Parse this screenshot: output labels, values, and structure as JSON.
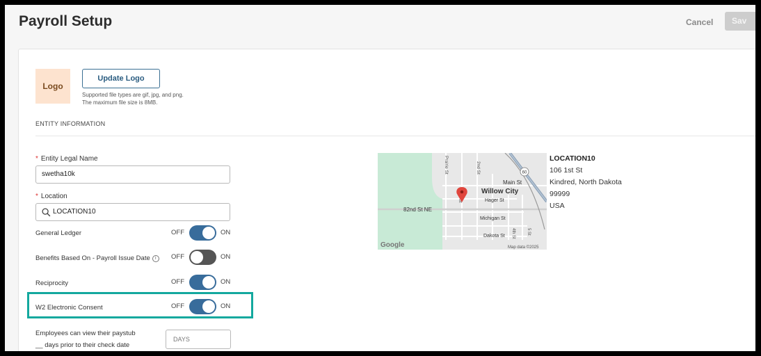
{
  "header": {
    "title": "Payroll Setup",
    "cancel_label": "Cancel",
    "save_label": "Sav"
  },
  "logo": {
    "placeholder_text": "Logo",
    "update_label": "Update Logo",
    "note_line1": "Supported file types are gif, jpg, and png.",
    "note_line2": "The maximum file size is 8MB."
  },
  "entity": {
    "heading": "ENTITY INFORMATION",
    "legal_name_label": "Entity Legal Name",
    "legal_name_value": "swetha10k",
    "location_label": "Location",
    "location_value": "LOCATION10",
    "required_marker": "*"
  },
  "toggles": {
    "off_label": "OFF",
    "on_label": "ON",
    "items": [
      {
        "label": "General Ledger",
        "state": "on"
      },
      {
        "label": "Benefits Based On - Payroll Issue Date",
        "state": "off"
      },
      {
        "label": "Reciprocity",
        "state": "on"
      },
      {
        "label": "W2 Electronic Consent",
        "state": "on"
      }
    ]
  },
  "paystub": {
    "line1": "Employees can view their paystub",
    "line2": "__ days prior to their check date",
    "days_placeholder": "DAYS"
  },
  "map": {
    "city_label": "Willow City",
    "streets": [
      "Prairie St",
      "2nd St",
      "Main St",
      "Hager St",
      "82nd St NE",
      "Michigan St",
      "Dakota St",
      "4th St",
      "5 St",
      "St"
    ],
    "route_number": "60",
    "attribution": "Map data ©2025",
    "brand": "Google"
  },
  "address": {
    "name": "LOCATION10",
    "line1": "106 1st St",
    "line2": "Kindred, North Dakota",
    "line3": "99999",
    "line4": "USA"
  },
  "colors": {
    "accent": "#386c9b",
    "highlight": "#13a89e",
    "logo_bg": "#fde3cf"
  }
}
